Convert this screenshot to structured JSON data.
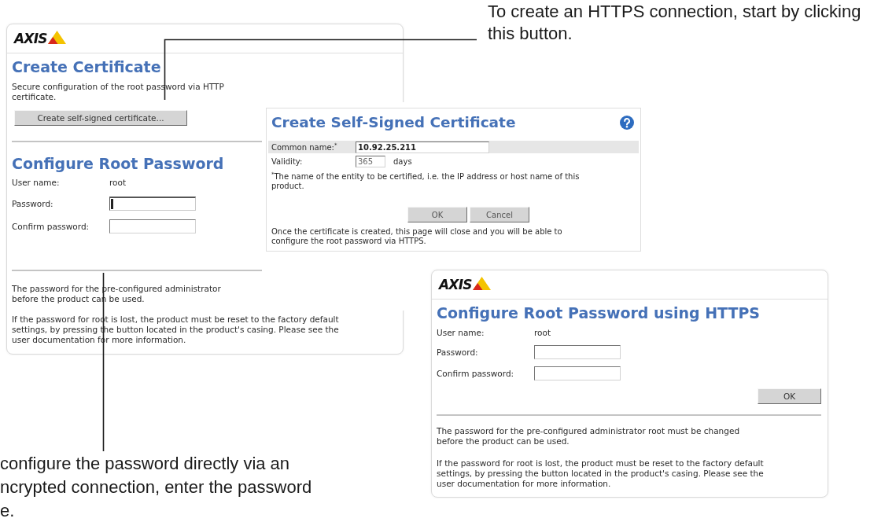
{
  "callout_top": {
    "lines": [
      "To create an HTTPS connection, start by clicking",
      "this button."
    ]
  },
  "root_password_page": {
    "logo": "AXIS",
    "certificate": {
      "title": "Create Certificate",
      "text": [
        "Secure configuration of the root password via HTTP",
        "certificate."
      ],
      "button": "Create self-signed certificate..."
    },
    "password": {
      "title": "Configure Root Password",
      "fields": [
        {
          "kind": "text",
          "label": "User name:",
          "value": "root"
        },
        {
          "kind": "input",
          "label": "Password:",
          "focused": true
        },
        {
          "kind": "input",
          "label": "Confirm password:",
          "focused": false
        }
      ]
    },
    "notes": [
      {
        "lines": [
          "The password for the pre-configured administrator",
          "before the product can be used."
        ]
      },
      {
        "lines": [
          "If the password for root is lost, the product must be reset to the factory default",
          "settings, by pressing the button located in the product's casing. Please see the",
          "user documentation for more information."
        ]
      }
    ]
  },
  "certificate_dialog": {
    "title": "Create Self-Signed Certificate",
    "fields": [
      {
        "label": "Common name:$^{*}$",
        "value": "10.92.25.211",
        "highlighted": true
      },
      {
        "label": "Validity:",
        "value": "365",
        "unit": "days",
        "highlighted": false
      }
    ],
    "footnote": [
      "$^{*}$The name of the entity to be certified, i.e. the IP address or host name of this",
      "product."
    ],
    "buttons": [
      "OK",
      "Cancel"
    ],
    "note": [
      "Once the certificate is created, this page will close and you will be able to",
      "configure the root password via HTTPS."
    ]
  },
  "https_password_page": {
    "logo": "AXIS",
    "title": "Configure Root Password using HTTPS",
    "fields": [
      {
        "kind": "text",
        "label": "User name:",
        "value": "root"
      },
      {
        "kind": "input",
        "label": "Password:",
        "focused": false
      },
      {
        "kind": "input",
        "label": "Confirm password:",
        "focused": false
      }
    ],
    "button": "OK",
    "notes": [
      {
        "lines": [
          "The password for the pre-configured administrator root must be changed",
          "before the product can be used."
        ]
      },
      {
        "lines": [
          "If the password for root is lost, the product must be reset to the factory default",
          "settings, by pressing the button located in the product's casing. Please see the",
          "user documentation for more information."
        ]
      }
    ]
  },
  "callout_bottom": {
    "lines": [
      "configure the password directly via an",
      "ncrypted connection, enter the password",
      "e."
    ]
  }
}
